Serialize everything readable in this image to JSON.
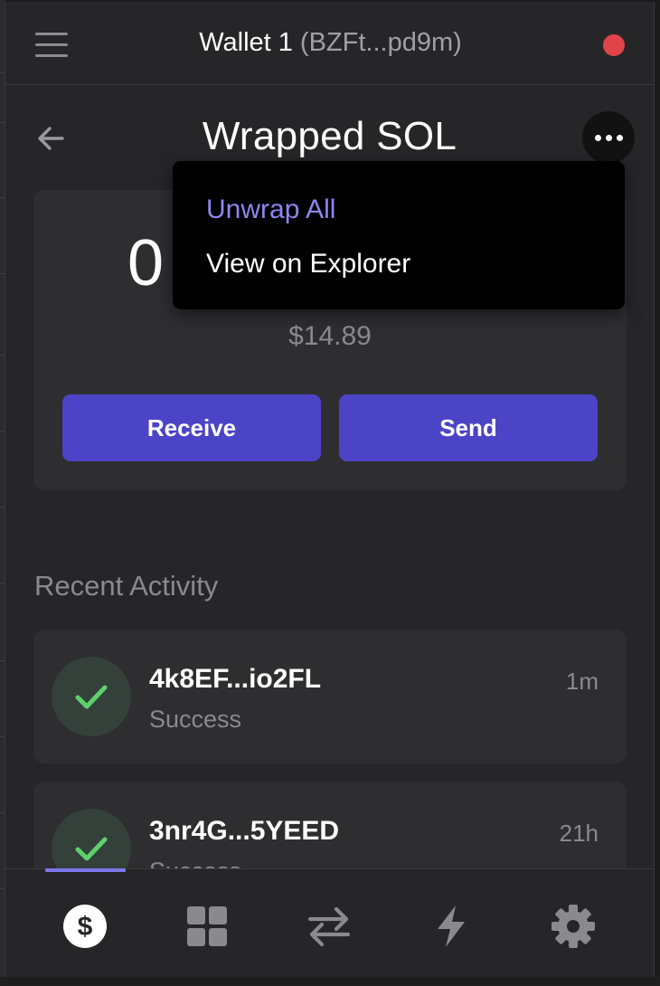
{
  "header": {
    "wallet_name": "Wallet 1",
    "wallet_address": "(BZFt...pd9m)",
    "status_color": "#e0444a"
  },
  "token": {
    "title": "Wrapped SOL",
    "balance": "0",
    "usd_value": "$14.89"
  },
  "actions": {
    "receive_label": "Receive",
    "send_label": "Send"
  },
  "menu": {
    "unwrap_label": "Unwrap All",
    "explorer_label": "View on Explorer"
  },
  "activity": {
    "heading": "Recent Activity",
    "items": [
      {
        "signature": "4k8EF...io2FL",
        "status": "Success",
        "time": "1m"
      },
      {
        "signature": "3nr4G...5YEED",
        "status": "Success",
        "time": "21h"
      }
    ]
  },
  "nav": {
    "items": [
      "dollar-icon",
      "grid-icon",
      "swap-icon",
      "lightning-icon",
      "gear-icon"
    ],
    "active": "dollar-icon"
  },
  "colors": {
    "accent": "#4c44c6",
    "accent_light": "#8e86f0",
    "success": "#5ed06b",
    "background": "#262628",
    "card": "#2e2e30"
  }
}
